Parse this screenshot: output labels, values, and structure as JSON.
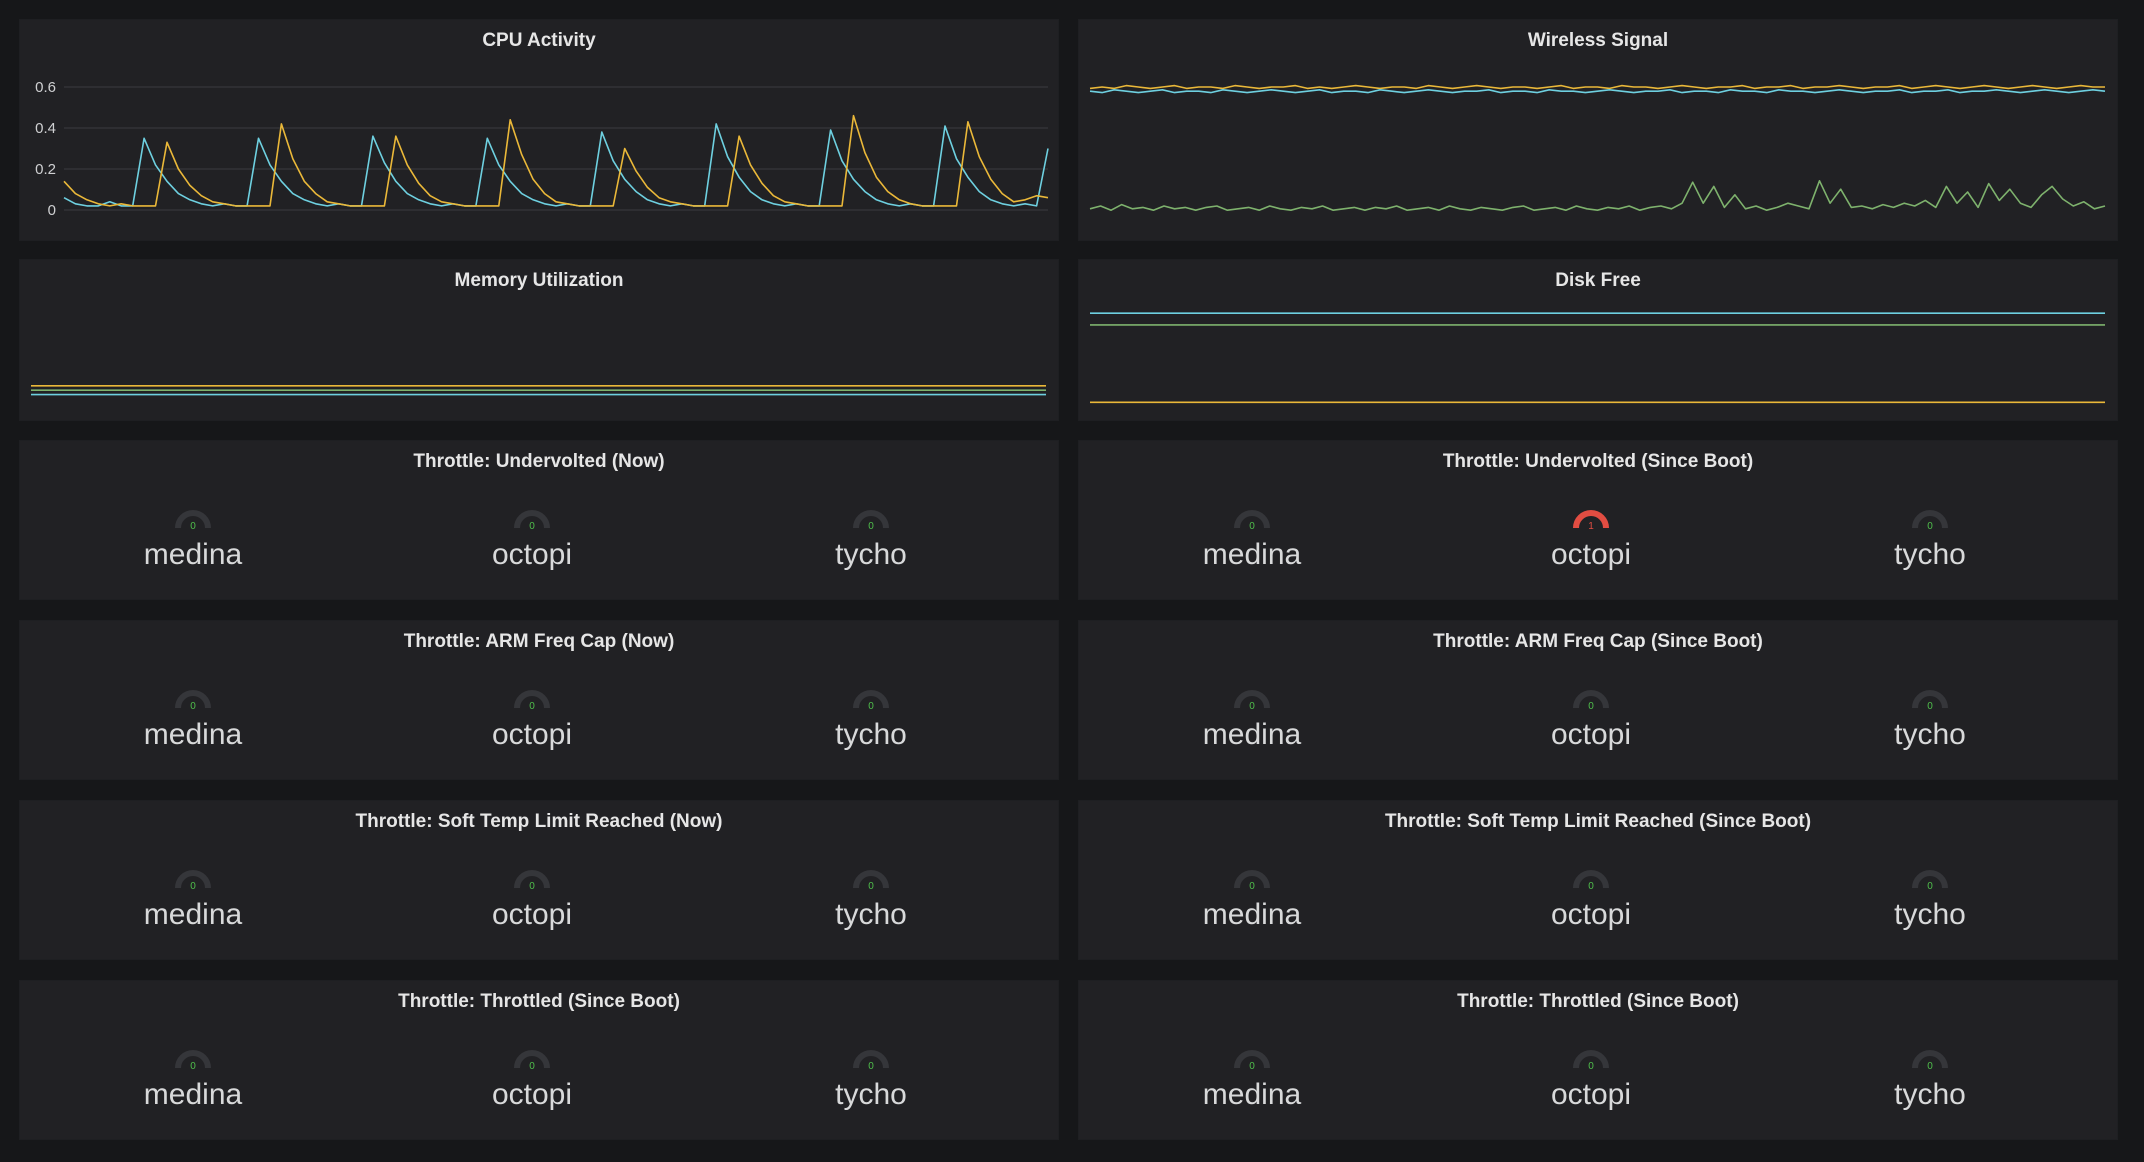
{
  "colors": {
    "background": "#161719",
    "panel": "#212124",
    "series_blue": "#6ed0e0",
    "series_yellow": "#eab839",
    "series_green": "#7eb26d",
    "gauge_ok_text": "#4fbf4b",
    "gauge_track": "#35363a",
    "gauge_alert": "#e24d42"
  },
  "charts": [
    {
      "id": "cpu",
      "title": "CPU Activity",
      "chart_data": {
        "type": "line",
        "ylim": [
          0,
          0.6
        ],
        "yticks": [
          "0",
          "0.2",
          "0.4",
          "0.6"
        ],
        "grid": true,
        "series": [
          {
            "color": "#6ed0e0",
            "values": [
              0.06,
              0.03,
              0.02,
              0.02,
              0.04,
              0.02,
              0.02,
              0.35,
              0.22,
              0.14,
              0.08,
              0.05,
              0.03,
              0.02,
              0.03,
              0.02,
              0.02,
              0.35,
              0.22,
              0.14,
              0.08,
              0.05,
              0.03,
              0.02,
              0.03,
              0.02,
              0.02,
              0.36,
              0.23,
              0.14,
              0.08,
              0.05,
              0.03,
              0.02,
              0.03,
              0.02,
              0.02,
              0.35,
              0.22,
              0.14,
              0.08,
              0.05,
              0.03,
              0.02,
              0.03,
              0.02,
              0.02,
              0.38,
              0.24,
              0.15,
              0.09,
              0.05,
              0.03,
              0.02,
              0.03,
              0.02,
              0.02,
              0.42,
              0.26,
              0.16,
              0.09,
              0.05,
              0.03,
              0.02,
              0.03,
              0.02,
              0.02,
              0.39,
              0.24,
              0.15,
              0.09,
              0.05,
              0.03,
              0.02,
              0.03,
              0.02,
              0.02,
              0.41,
              0.25,
              0.16,
              0.09,
              0.05,
              0.03,
              0.02,
              0.03,
              0.02,
              0.3
            ]
          },
          {
            "color": "#eab839",
            "values": [
              0.14,
              0.08,
              0.05,
              0.03,
              0.02,
              0.03,
              0.02,
              0.02,
              0.02,
              0.33,
              0.2,
              0.12,
              0.07,
              0.04,
              0.03,
              0.02,
              0.02,
              0.02,
              0.02,
              0.42,
              0.25,
              0.14,
              0.08,
              0.04,
              0.03,
              0.02,
              0.02,
              0.02,
              0.02,
              0.36,
              0.22,
              0.13,
              0.07,
              0.04,
              0.03,
              0.02,
              0.02,
              0.02,
              0.02,
              0.44,
              0.27,
              0.15,
              0.08,
              0.04,
              0.03,
              0.02,
              0.02,
              0.02,
              0.02,
              0.3,
              0.19,
              0.11,
              0.06,
              0.04,
              0.03,
              0.02,
              0.02,
              0.02,
              0.02,
              0.36,
              0.22,
              0.13,
              0.07,
              0.04,
              0.03,
              0.02,
              0.02,
              0.02,
              0.02,
              0.46,
              0.28,
              0.16,
              0.09,
              0.05,
              0.03,
              0.02,
              0.02,
              0.02,
              0.02,
              0.43,
              0.26,
              0.15,
              0.08,
              0.04,
              0.05,
              0.07,
              0.06
            ]
          }
        ]
      }
    },
    {
      "id": "wireless",
      "title": "Wireless Signal",
      "chart_data": {
        "type": "line",
        "ylim": [
          0,
          1
        ],
        "grid": false,
        "series": [
          {
            "color": "#eab839",
            "values": [
              0.94,
              0.95,
              0.94,
              0.96,
              0.95,
              0.94,
              0.95,
              0.96,
              0.94,
              0.95,
              0.95,
              0.94,
              0.96,
              0.95,
              0.94,
              0.95,
              0.95,
              0.96,
              0.94,
              0.95,
              0.94,
              0.95,
              0.96,
              0.95,
              0.94,
              0.95,
              0.95,
              0.94,
              0.96,
              0.95,
              0.94,
              0.95,
              0.96,
              0.95,
              0.94,
              0.95,
              0.95,
              0.94,
              0.95,
              0.96,
              0.94,
              0.95,
              0.95,
              0.94,
              0.96,
              0.95,
              0.95,
              0.94,
              0.95,
              0.96,
              0.95,
              0.94,
              0.95,
              0.95,
              0.96,
              0.94,
              0.95,
              0.95,
              0.96,
              0.94,
              0.95,
              0.95,
              0.96,
              0.95,
              0.94,
              0.95,
              0.95,
              0.96,
              0.94,
              0.95,
              0.96,
              0.95,
              0.94,
              0.95,
              0.96,
              0.95,
              0.94,
              0.95,
              0.96,
              0.95,
              0.94,
              0.95,
              0.96,
              0.95,
              0.95
            ]
          },
          {
            "color": "#6ed0e0",
            "values": [
              0.92,
              0.91,
              0.93,
              0.92,
              0.91,
              0.92,
              0.93,
              0.91,
              0.92,
              0.92,
              0.91,
              0.93,
              0.92,
              0.91,
              0.92,
              0.93,
              0.92,
              0.91,
              0.92,
              0.93,
              0.91,
              0.92,
              0.92,
              0.91,
              0.93,
              0.92,
              0.91,
              0.92,
              0.93,
              0.92,
              0.91,
              0.92,
              0.92,
              0.93,
              0.91,
              0.92,
              0.92,
              0.91,
              0.93,
              0.92,
              0.92,
              0.91,
              0.92,
              0.93,
              0.92,
              0.91,
              0.92,
              0.92,
              0.93,
              0.91,
              0.92,
              0.92,
              0.91,
              0.93,
              0.92,
              0.92,
              0.91,
              0.93,
              0.92,
              0.92,
              0.91,
              0.92,
              0.93,
              0.92,
              0.91,
              0.92,
              0.92,
              0.93,
              0.91,
              0.92,
              0.92,
              0.93,
              0.91,
              0.92,
              0.92,
              0.93,
              0.92,
              0.91,
              0.92,
              0.93,
              0.92,
              0.91,
              0.92,
              0.93,
              0.92
            ]
          },
          {
            "color": "#7eb26d",
            "values": [
              0.08,
              0.1,
              0.07,
              0.11,
              0.08,
              0.09,
              0.07,
              0.1,
              0.08,
              0.09,
              0.07,
              0.09,
              0.1,
              0.07,
              0.08,
              0.09,
              0.07,
              0.1,
              0.08,
              0.07,
              0.09,
              0.08,
              0.1,
              0.07,
              0.08,
              0.09,
              0.07,
              0.09,
              0.08,
              0.1,
              0.07,
              0.08,
              0.09,
              0.07,
              0.1,
              0.08,
              0.07,
              0.09,
              0.08,
              0.07,
              0.09,
              0.1,
              0.07,
              0.08,
              0.09,
              0.07,
              0.1,
              0.08,
              0.07,
              0.09,
              0.08,
              0.1,
              0.07,
              0.09,
              0.1,
              0.08,
              0.12,
              0.27,
              0.12,
              0.24,
              0.09,
              0.18,
              0.08,
              0.1,
              0.07,
              0.09,
              0.12,
              0.1,
              0.08,
              0.28,
              0.12,
              0.22,
              0.09,
              0.1,
              0.08,
              0.11,
              0.09,
              0.12,
              0.1,
              0.14,
              0.09,
              0.24,
              0.12,
              0.2,
              0.09,
              0.26,
              0.14,
              0.22,
              0.12,
              0.09,
              0.18,
              0.24,
              0.15,
              0.1,
              0.13,
              0.08,
              0.1
            ]
          }
        ]
      }
    },
    {
      "id": "memory",
      "title": "Memory Utilization",
      "chart_data": {
        "type": "line",
        "ylim": [
          0,
          1
        ],
        "grid": false,
        "series": [
          {
            "color": "#eab839",
            "values": [
              0.22,
              0.22,
              0.22,
              0.22,
              0.22,
              0.22,
              0.22,
              0.22,
              0.22,
              0.22
            ]
          },
          {
            "color": "#7eb26d",
            "values": [
              0.18,
              0.18,
              0.18,
              0.18,
              0.18,
              0.18,
              0.18,
              0.18,
              0.18,
              0.18
            ]
          },
          {
            "color": "#6ed0e0",
            "values": [
              0.14,
              0.14,
              0.14,
              0.14,
              0.14,
              0.14,
              0.14,
              0.14,
              0.14,
              0.14
            ]
          }
        ]
      }
    },
    {
      "id": "disk",
      "title": "Disk Free",
      "chart_data": {
        "type": "line",
        "ylim": [
          0,
          1
        ],
        "grid": false,
        "series": [
          {
            "color": "#6ed0e0",
            "values": [
              0.96,
              0.96,
              0.96,
              0.96,
              0.96,
              0.96,
              0.96,
              0.96,
              0.96,
              0.96
            ]
          },
          {
            "color": "#7eb26d",
            "values": [
              0.85,
              0.85,
              0.85,
              0.85,
              0.85,
              0.85,
              0.85,
              0.85,
              0.85,
              0.85
            ]
          },
          {
            "color": "#eab839",
            "values": [
              0.12,
              0.12,
              0.12,
              0.12,
              0.12,
              0.12,
              0.12,
              0.12,
              0.12,
              0.12
            ]
          }
        ]
      }
    }
  ],
  "gauge_panels": [
    {
      "title": "Throttle: Undervolted (Now)",
      "gauges": [
        {
          "name": "medina",
          "value": "0"
        },
        {
          "name": "octopi",
          "value": "0"
        },
        {
          "name": "tycho",
          "value": "0"
        }
      ]
    },
    {
      "title": "Throttle: Undervolted (Since Boot)",
      "gauges": [
        {
          "name": "medina",
          "value": "0"
        },
        {
          "name": "octopi",
          "value": "1"
        },
        {
          "name": "tycho",
          "value": "0"
        }
      ]
    },
    {
      "title": "Throttle: ARM Freq Cap (Now)",
      "gauges": [
        {
          "name": "medina",
          "value": "0"
        },
        {
          "name": "octopi",
          "value": "0"
        },
        {
          "name": "tycho",
          "value": "0"
        }
      ]
    },
    {
      "title": "Throttle: ARM Freq Cap (Since Boot)",
      "gauges": [
        {
          "name": "medina",
          "value": "0"
        },
        {
          "name": "octopi",
          "value": "0"
        },
        {
          "name": "tycho",
          "value": "0"
        }
      ]
    },
    {
      "title": "Throttle: Soft Temp Limit Reached (Now)",
      "gauges": [
        {
          "name": "medina",
          "value": "0"
        },
        {
          "name": "octopi",
          "value": "0"
        },
        {
          "name": "tycho",
          "value": "0"
        }
      ]
    },
    {
      "title": "Throttle: Soft Temp Limit Reached (Since Boot)",
      "gauges": [
        {
          "name": "medina",
          "value": "0"
        },
        {
          "name": "octopi",
          "value": "0"
        },
        {
          "name": "tycho",
          "value": "0"
        }
      ]
    },
    {
      "title": "Throttle: Throttled (Since Boot)",
      "gauges": [
        {
          "name": "medina",
          "value": "0"
        },
        {
          "name": "octopi",
          "value": "0"
        },
        {
          "name": "tycho",
          "value": "0"
        }
      ]
    },
    {
      "title": "Throttle: Throttled (Since Boot)",
      "gauges": [
        {
          "name": "medina",
          "value": "0"
        },
        {
          "name": "octopi",
          "value": "0"
        },
        {
          "name": "tycho",
          "value": "0"
        }
      ]
    }
  ]
}
